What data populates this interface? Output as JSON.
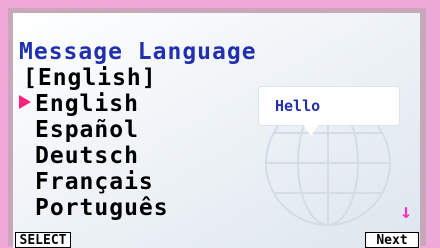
{
  "screen": {
    "title": "Message Language",
    "current_value": "[English]",
    "languages": [
      {
        "label": "English",
        "selected": true
      },
      {
        "label": "Español",
        "selected": false
      },
      {
        "label": "Deutsch",
        "selected": false
      },
      {
        "label": "Français",
        "selected": false
      },
      {
        "label": "Português",
        "selected": false
      }
    ],
    "preview_text": "Hello",
    "scroll_indicator": "↓"
  },
  "softkeys": {
    "left": "SELECT",
    "right": "Next"
  },
  "colors": {
    "title": "#2030b0",
    "cursor": "#ff2080",
    "background": "#f0a8d8"
  }
}
